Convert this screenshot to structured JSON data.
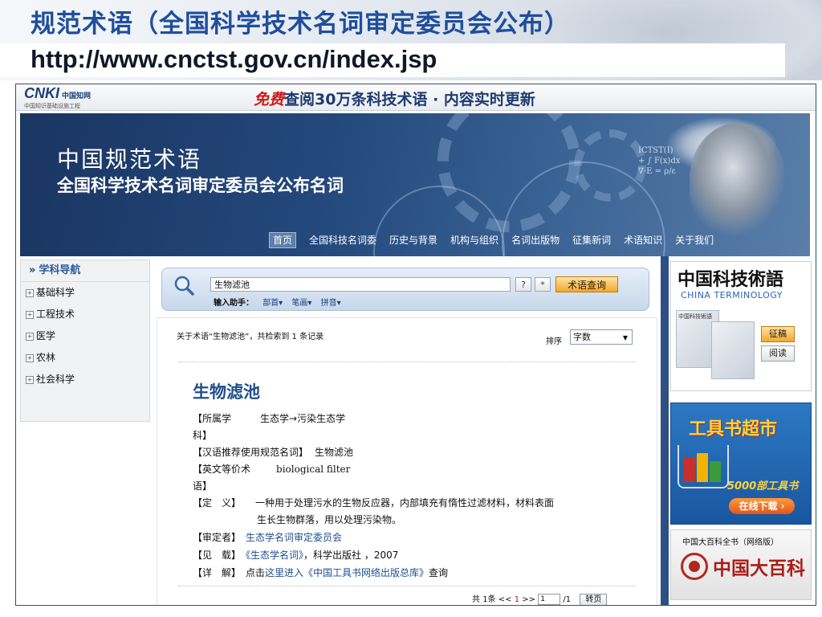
{
  "slide": {
    "title": "规范术语（全国科学技术名词审定委员会公布）",
    "url": "http://www.cnctst.gov.cn/index.jsp"
  },
  "topstrip": {
    "logo_text": "CNKI",
    "logo_cn": "中国知网",
    "logo_sub": "中国知识基础设施工程",
    "promo_free": "免费",
    "promo_rest": "查阅30万条科技术语 · 内容实时更新"
  },
  "banner": {
    "title1": "中国规范术语",
    "title2": "全国科学技术名词审定委员会公布名词",
    "nav": [
      "首页",
      "全国科技名词委",
      "历史与背景",
      "机构与组织",
      "名词出版物",
      "征集新词",
      "术语知识",
      "关于我们"
    ]
  },
  "sidebar": {
    "title": "学科导航",
    "items": [
      "基础科学",
      "工程技术",
      "医学",
      "农林",
      "社会科学"
    ]
  },
  "search": {
    "value": "生物滤池",
    "qmark": "?",
    "star": "*",
    "button": "术语查询",
    "helper_label": "输入助手：",
    "helper_options": [
      "部首▾",
      "笔画▾",
      "拼音▾"
    ]
  },
  "results": {
    "summary": "关于术语“生物滤池”，共检索到 1 条记录",
    "sort_label": "排序",
    "sort_value": "字数",
    "term": "生物滤池",
    "field_category_label": "【所属学",
    "field_category_value": "生态学→污染生态学",
    "field_category_wrap": "科】",
    "field_cn_label": "【汉语推荐使用规范名词】",
    "field_cn_value": "生物滤池",
    "field_en_label": "【英文等价术",
    "field_en_value": "biological filter",
    "field_en_wrap": "语】",
    "field_def_label": "【定　义】",
    "field_def_line1": "一种用于处理污水的生物反应器，内部填充有惰性过滤材料，材料表面",
    "field_def_line2": "生长生物群落，用以处理污染物。",
    "field_reviewer_label": "【审定者】",
    "field_reviewer_value": "生态学名词审定委员会",
    "field_source_label": "【见　载】",
    "field_source_link": "《生态学名词》",
    "field_source_rest": "，科学出版社 ，2007",
    "field_detail_label": "【详　解】",
    "field_detail_pre": "点击",
    "field_detail_link": "这里进入《中国工具书网络出版总库》",
    "field_detail_post": "查询"
  },
  "pager": {
    "total_pre": "共",
    "total_num": "1",
    "total_post": "条",
    "prev": "<<",
    "current": "1",
    "next": ">>",
    "page_input": "1",
    "page_total": "/1",
    "go": "转页"
  },
  "ads": {
    "terminology_cn": "中国科技術語",
    "terminology_en": "CHINA TERMINOLOGY",
    "terminology_book": "中国科技術語",
    "btn_submit": "征稿",
    "btn_read": "阅读",
    "toolbook_title": "工具书超市",
    "toolbook_count": "5000部工具书",
    "toolbook_download": "在线下载 ›",
    "encyclopedia_title": "中国大百科全书（网络版）",
    "encyclopedia_brand": "中国大百科"
  },
  "colors": {
    "slide_title": "#1f4e9c",
    "banner": "#24497d",
    "link": "#1f4e8c",
    "query_button": "#f4a72b"
  }
}
